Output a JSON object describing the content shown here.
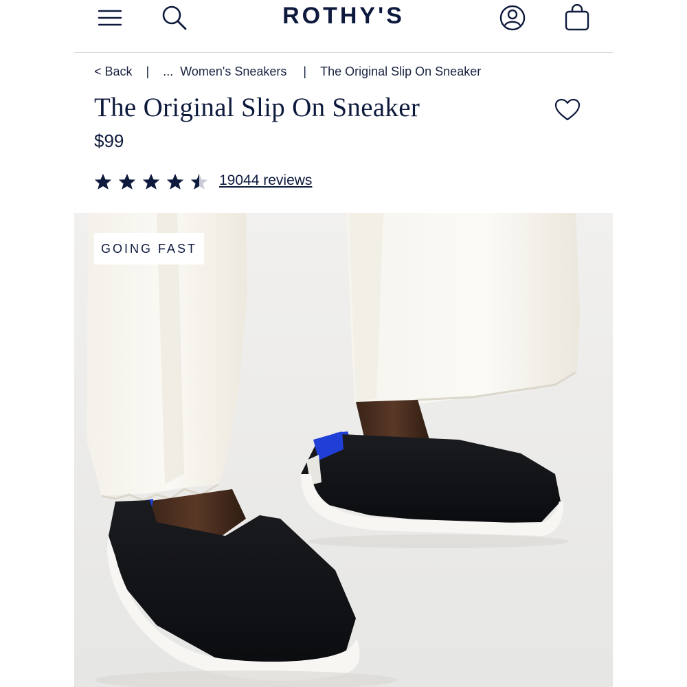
{
  "header": {
    "logo": "ROTHY'S",
    "icons": [
      "menu-icon",
      "search-icon",
      "account-icon",
      "bag-icon"
    ]
  },
  "breadcrumb": {
    "back_label": "< Back",
    "separator": "|",
    "ellipsis": "...",
    "category": "Women's Sneakers",
    "current": "The Original Slip On Sneaker"
  },
  "product": {
    "title": "The Original Slip On Sneaker",
    "price": "$99",
    "rating": 4.5,
    "rating_max": 5,
    "reviews_label": "19044 reviews",
    "favorite_icon": "heart-icon"
  },
  "hero": {
    "badge": "GOING FAST"
  },
  "colors": {
    "navy": "#0e1a3d",
    "accent_blue": "#1f3fd6"
  }
}
